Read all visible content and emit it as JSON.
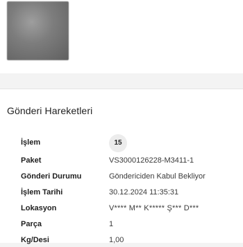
{
  "section": {
    "title": "Gönderi Hareketleri"
  },
  "details": [
    {
      "key": "islem",
      "label": "İşlem",
      "value": "15"
    },
    {
      "key": "paket",
      "label": "Paket",
      "value": "VS3000126228-M3411-1"
    },
    {
      "key": "durum",
      "label": "Gönderi Durumu",
      "value": "Göndericiden Kabul Bekliyor"
    },
    {
      "key": "tarih",
      "label": "İşlem Tarihi",
      "value": "30.12.2024 11:35:31"
    },
    {
      "key": "lokasyon",
      "label": "Lokasyon",
      "value": "V**** M** K***** Ş*** D***"
    },
    {
      "key": "parca",
      "label": "Parça",
      "value": "1"
    },
    {
      "key": "kgdesi",
      "label": "Kg/Desi",
      "value": "1,00"
    }
  ]
}
